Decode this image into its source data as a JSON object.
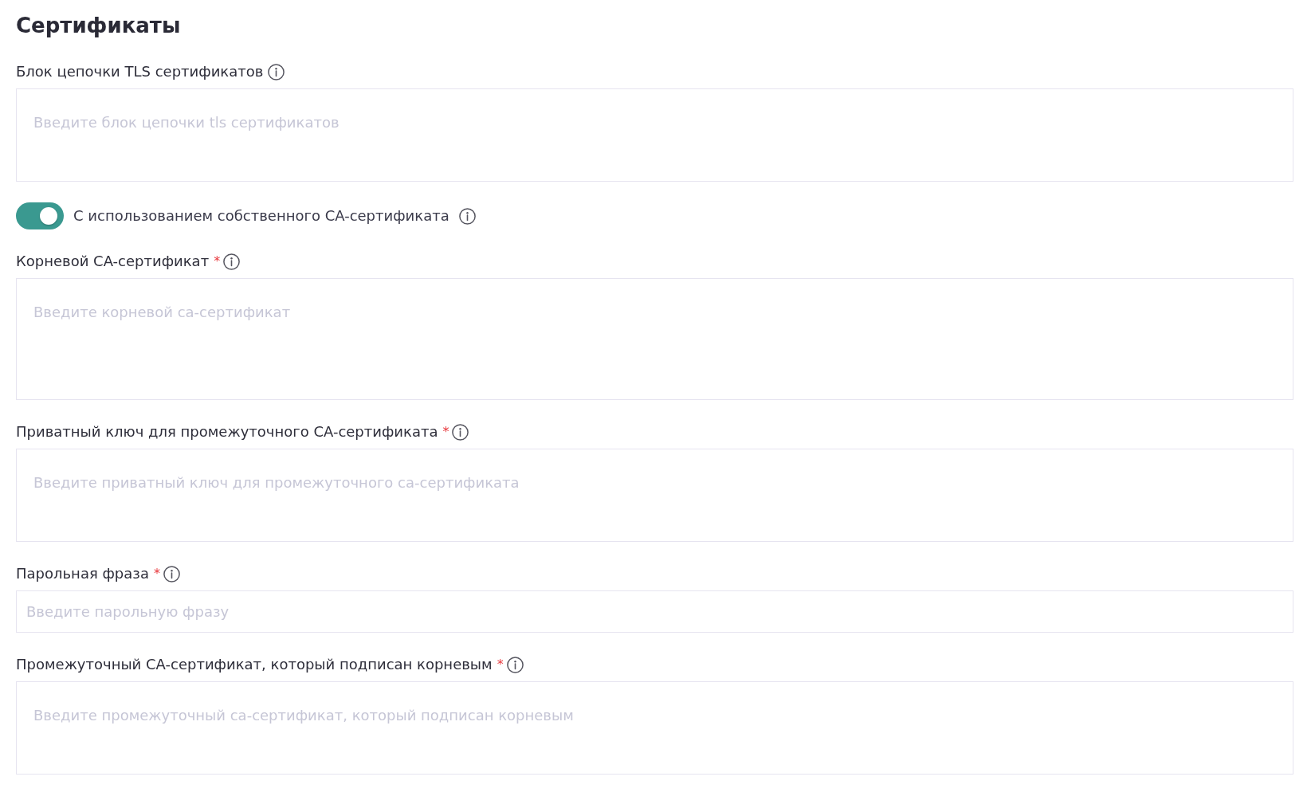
{
  "title": "Сертификаты",
  "fields": [
    {
      "kind": "textarea",
      "label": "Блок цепочки TLS сертификатов",
      "placeholder": "Введите блок цепочки tls сертификатов"
    },
    {
      "kind": "toggle",
      "label": "С использованием собственного CA-сертификата",
      "on": true
    },
    {
      "kind": "textarea",
      "label": "Корневой CA-сертификат",
      "required_mark": "*",
      "placeholder": "Введите корневой ca-сертификат"
    },
    {
      "kind": "textarea",
      "label": "Приватный ключ для промежуточного CA-сертификата",
      "required_mark": "*",
      "placeholder": "Введите приватный ключ для промежуточного ca-сертификата"
    },
    {
      "kind": "input",
      "label": "Парольная фраза",
      "required_mark": "*",
      "placeholder": "Введите парольную фразу"
    },
    {
      "kind": "textarea",
      "label": "Промежуточный CA-сертификат, который подписан корневым",
      "required_mark": "*",
      "placeholder": "Введите промежуточный ca-сертификат, который подписан корневым"
    }
  ]
}
